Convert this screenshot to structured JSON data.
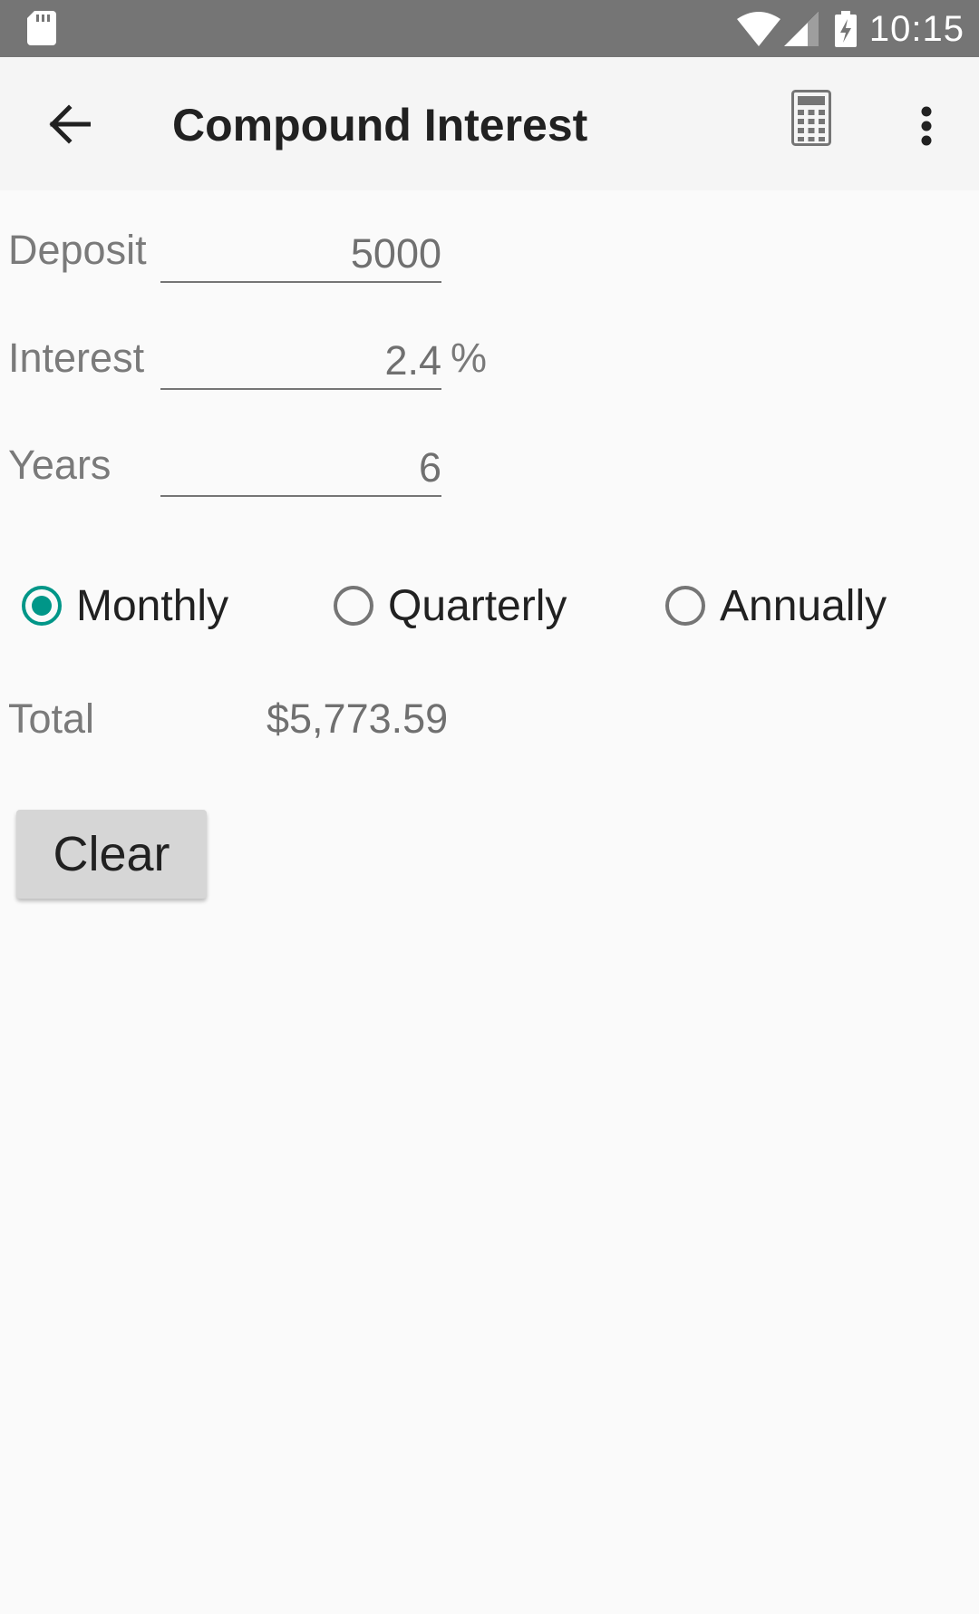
{
  "status_bar": {
    "time": "10:15",
    "icons": [
      "sd-card-icon",
      "wifi-icon",
      "signal-icon",
      "battery-charging-icon"
    ]
  },
  "app_bar": {
    "title": "Compound Interest",
    "icons": [
      "back-arrow-icon",
      "calculator-icon",
      "more-vert-icon"
    ]
  },
  "form": {
    "deposit": {
      "label": "Deposit",
      "value": "5000"
    },
    "interest": {
      "label": "Interest",
      "value": "2.4",
      "suffix": "%"
    },
    "years": {
      "label": "Years",
      "value": "6"
    }
  },
  "compounding": {
    "options": [
      {
        "label": "Monthly",
        "checked": true
      },
      {
        "label": "Quarterly",
        "checked": false
      },
      {
        "label": "Annually",
        "checked": false
      }
    ]
  },
  "result": {
    "label": "Total",
    "value": "$5,773.59"
  },
  "actions": {
    "clear_label": "Clear"
  },
  "colors": {
    "accent": "#009688",
    "status_bar": "#757575",
    "app_bar": "#f5f5f5",
    "background": "#fafafa"
  }
}
